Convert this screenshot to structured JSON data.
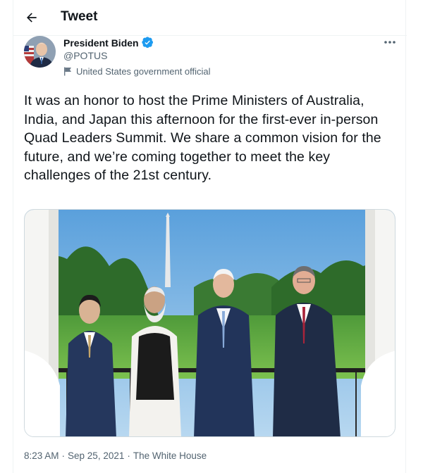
{
  "header": {
    "title": "Tweet"
  },
  "author": {
    "name": "President Biden",
    "handle": "@POTUS",
    "label": "United States government official"
  },
  "tweet": {
    "text": "It was an honor to host the Prime Ministers of Australia, India, and Japan this afternoon for the first-ever in-person Quad Leaders Summit. We share a common vision for the future, and we’re coming together to meet the key challenges of the 21st century.",
    "time": "8:23 AM",
    "sep1": "·",
    "date": "Sep 25, 2021",
    "sep2": "·",
    "source": "The White House"
  },
  "colors": {
    "accent": "#1d9bf0",
    "text": "#0f1419",
    "muted": "#536471",
    "border": "#cfd9de"
  },
  "icons": [
    "back-arrow-icon",
    "verified-badge-icon",
    "flag-icon",
    "more-icon"
  ]
}
